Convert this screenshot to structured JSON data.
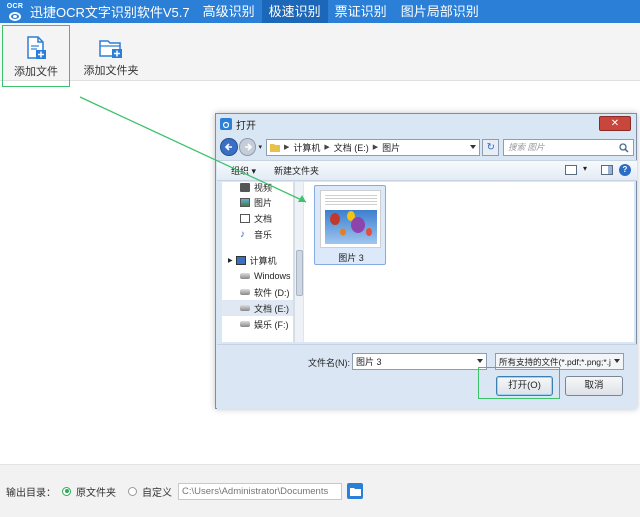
{
  "app": {
    "logo_text": "OCR",
    "title": "迅捷OCR文字识别软件V5.7",
    "tabs": [
      {
        "label": "高级识别",
        "active": false
      },
      {
        "label": "极速识别",
        "active": true
      },
      {
        "label": "票证识别",
        "active": false
      },
      {
        "label": "图片局部识别",
        "active": false
      }
    ]
  },
  "toolbar": {
    "add_file_label": "添加文件",
    "add_folder_label": "添加文件夹"
  },
  "dialog": {
    "title": "打开",
    "close_label": "✕",
    "breadcrumb": [
      "计算机",
      "文档 (E:)",
      "图片"
    ],
    "search_placeholder": "搜索 图片",
    "organize_label": "组织 ▾",
    "new_folder_label": "新建文件夹",
    "nav_items": [
      {
        "label": "视频",
        "icon": "video-icon"
      },
      {
        "label": "图片",
        "icon": "picture-icon"
      },
      {
        "label": "文档",
        "icon": "document-icon"
      },
      {
        "label": "音乐",
        "icon": "music-icon"
      },
      {
        "label": "计算机",
        "icon": "computer-icon"
      },
      {
        "label": "Windows",
        "icon": "drive-icon"
      },
      {
        "label": "软件 (D:)",
        "icon": "drive-icon"
      },
      {
        "label": "文档 (E:)",
        "icon": "drive-icon"
      },
      {
        "label": "娱乐 (F:)",
        "icon": "drive-icon"
      }
    ],
    "file_item_label": "图片 3",
    "filename_label": "文件名(N):",
    "filename_value": "图片 3",
    "filetype_value": "所有支持的文件(*.pdf;*.png;*.j",
    "open_label": "打开(O)",
    "cancel_label": "取消"
  },
  "output": {
    "label": "输出目录：",
    "option_original": "原文件夹",
    "option_custom": "自定义",
    "path_placeholder": "C:\\Users\\Administrator\\Documents"
  },
  "colors": {
    "brand": "#2b7fd6",
    "highlight": "#3cc26b"
  }
}
